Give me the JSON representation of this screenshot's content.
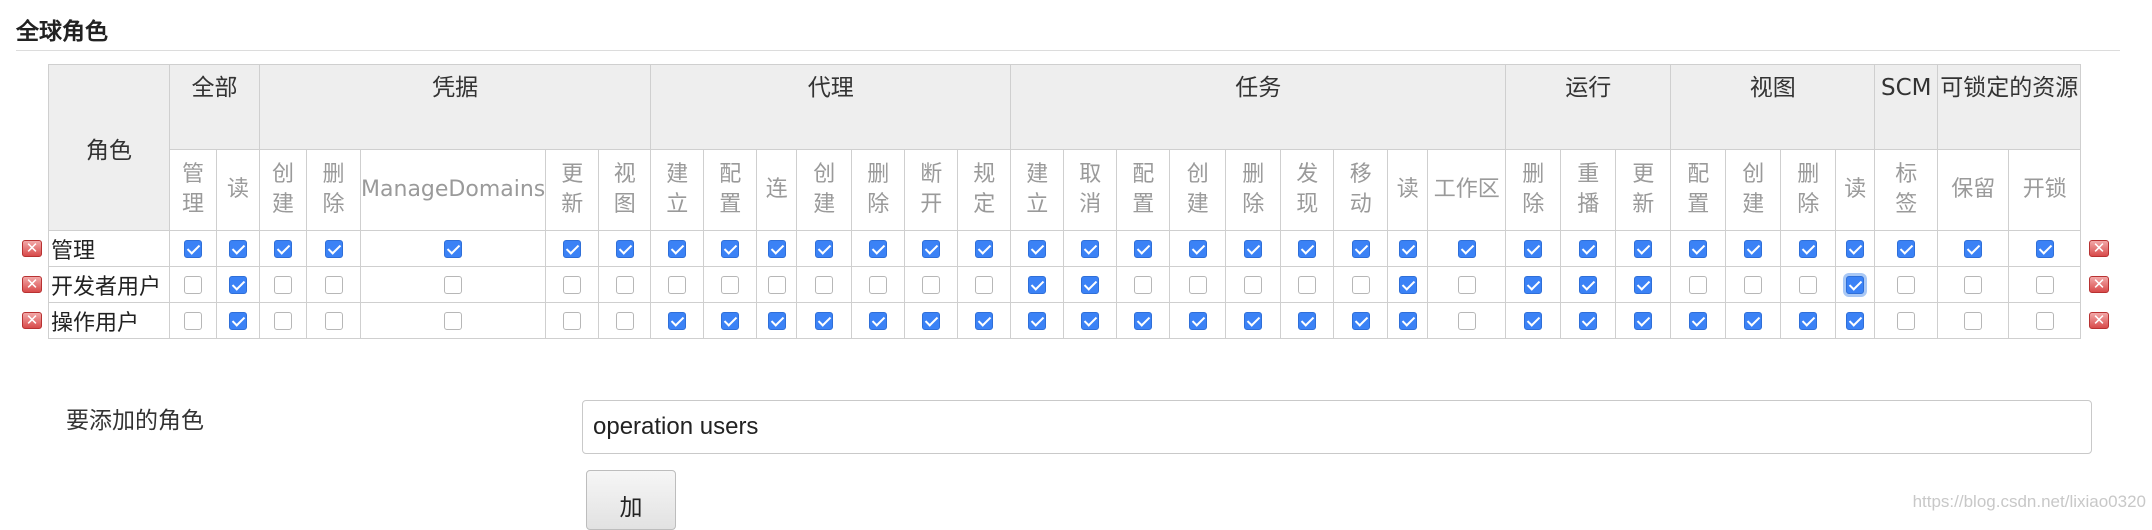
{
  "title": "全球角色",
  "role_header": "角色",
  "groups": [
    {
      "name": "全部",
      "span": 2
    },
    {
      "name": "凭据",
      "span": 5
    },
    {
      "name": "代理",
      "span": 7
    },
    {
      "name": "任务",
      "span": 9
    },
    {
      "name": "运行",
      "span": 3
    },
    {
      "name": "视图",
      "span": 4
    },
    {
      "name": "SCM",
      "span": 1
    },
    {
      "name": "可锁定的资源",
      "span": 2
    }
  ],
  "permissions": [
    {
      "label": "管理",
      "w": 44
    },
    {
      "label": "读",
      "w": 43
    },
    {
      "label": "创建",
      "w": 46
    },
    {
      "label": "删除",
      "w": 54
    },
    {
      "label": "ManageDomains",
      "w": 184
    },
    {
      "label": "更新",
      "w": 53
    },
    {
      "label": "视图",
      "w": 52
    },
    {
      "label": "建立",
      "w": 53
    },
    {
      "label": "配置",
      "w": 53
    },
    {
      "label": "连",
      "w": 40
    },
    {
      "label": "创建",
      "w": 55
    },
    {
      "label": "删除",
      "w": 53
    },
    {
      "label": "断开",
      "w": 53
    },
    {
      "label": "规定",
      "w": 53
    },
    {
      "label": "建立",
      "w": 53
    },
    {
      "label": "取消",
      "w": 53
    },
    {
      "label": "配置",
      "w": 53
    },
    {
      "label": "创建",
      "w": 56
    },
    {
      "label": "删除",
      "w": 55
    },
    {
      "label": "发现",
      "w": 53
    },
    {
      "label": "移动",
      "w": 54
    },
    {
      "label": "读",
      "w": 40
    },
    {
      "label": "工作区",
      "w": 78
    },
    {
      "label": "删除",
      "w": 55
    },
    {
      "label": "重播",
      "w": 55
    },
    {
      "label": "更新",
      "w": 55
    },
    {
      "label": "配置",
      "w": 55
    },
    {
      "label": "创建",
      "w": 55
    },
    {
      "label": "删除",
      "w": 55
    },
    {
      "label": "读",
      "w": 39
    },
    {
      "label": "标签",
      "w": 63
    },
    {
      "label": "保留",
      "w": 71
    },
    {
      "label": "开锁",
      "w": 72
    }
  ],
  "roles": [
    {
      "name": "管理",
      "perms": [
        1,
        1,
        1,
        1,
        1,
        1,
        1,
        1,
        1,
        1,
        1,
        1,
        1,
        1,
        1,
        1,
        1,
        1,
        1,
        1,
        1,
        1,
        1,
        1,
        1,
        1,
        1,
        1,
        1,
        1,
        1,
        1,
        1
      ]
    },
    {
      "name": "开发者用户",
      "perms": [
        0,
        1,
        0,
        0,
        0,
        0,
        0,
        0,
        0,
        0,
        0,
        0,
        0,
        0,
        1,
        1,
        0,
        0,
        0,
        0,
        0,
        1,
        0,
        1,
        1,
        1,
        0,
        0,
        0,
        1,
        0,
        0,
        0
      ],
      "focused": 29
    },
    {
      "name": "操作用户",
      "perms": [
        0,
        1,
        0,
        0,
        0,
        0,
        0,
        1,
        1,
        1,
        1,
        1,
        1,
        1,
        1,
        1,
        1,
        1,
        1,
        1,
        1,
        1,
        0,
        1,
        1,
        1,
        1,
        1,
        1,
        1,
        0,
        0,
        0
      ]
    }
  ],
  "add_role": {
    "label": "要添加的角色",
    "value": "operation users",
    "button_label": "加"
  },
  "watermark": "https://blog.csdn.net/lixiao0320",
  "colors": {
    "checkbox_checked": "#3b82f6",
    "delete_icon": "#d84a4a",
    "header_bg": "#eeeeee"
  },
  "icons": {
    "delete": "delete-role-icon",
    "x_glyph": "✕"
  }
}
